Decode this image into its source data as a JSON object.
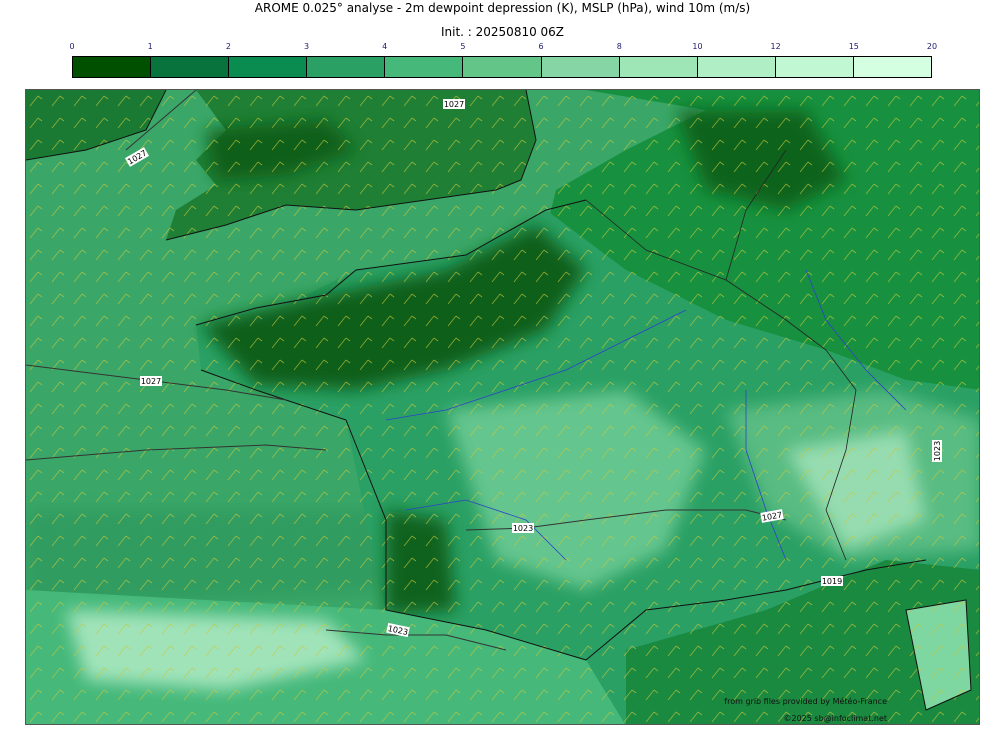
{
  "title": {
    "line1": "AROME 0.025° analyse - 2m dewpoint depression (K), MSLP (hPa), wind 10m (m/s)",
    "line2": "Init. : 20250810 06Z"
  },
  "colorbar": {
    "ticks": [
      "0",
      "1",
      "2",
      "3",
      "4",
      "5",
      "6",
      "8",
      "10",
      "12",
      "15",
      "20"
    ],
    "colors": [
      "#005000",
      "#08733c",
      "#0a8c50",
      "#2aa064",
      "#45b87a",
      "#63c587",
      "#86d6a5",
      "#9ee6b6",
      "#b0efc6",
      "#c2f7d4",
      "#d4ffe0"
    ]
  },
  "isobar_labels": [
    "1027",
    "1027",
    "1027",
    "1023",
    "1027",
    "1019",
    "1023",
    "1023"
  ],
  "map_colors": {
    "sea": "#3aa768",
    "land_dark": "#0b5c12",
    "land_mid": "#17913f",
    "land_light": "#7ed6a0",
    "mountains": "#bff2cf",
    "coast": "#111111",
    "rivers": "#2d43c8",
    "wind_barbs": "#c8c83a"
  },
  "credits": {
    "source": "from grib files provided by Météo-France",
    "copyright": "©2025 sb@infoclimat.net"
  }
}
